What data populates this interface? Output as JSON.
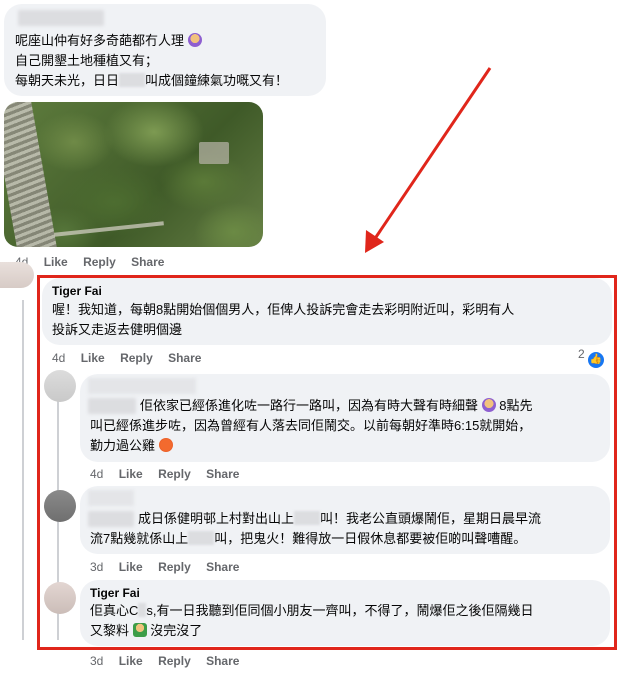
{
  "comment1": {
    "lines": [
      "呢座山仲有好多奇葩都冇人理",
      "自己開墾土地種植又有；",
      "每朝天未光，日日",
      "叫成個鐘練氣功嘅又有！"
    ],
    "time": "4d",
    "like": "Like",
    "reply": "Reply",
    "share": "Share"
  },
  "reply1": {
    "name": "Tiger Fai",
    "lines": [
      "喔！我知道，每朝8點開始個個男人，佢俾人投訴完會走去彩明附近叫，彩明有人",
      "投訴又走返去健明個邊"
    ],
    "time": "4d",
    "like": "Like",
    "reply": "Reply",
    "share": "Share",
    "reaction_count": "2"
  },
  "reply2": {
    "lines": [
      "佢依家已經係進化咗一路行一路叫，因為有時大聲有時細聲",
      "8點先",
      "叫已經係進步咗，因為曾經有人落去同佢鬧交。以前每朝好準時6:15就開始，",
      "勤力過公雞"
    ],
    "time": "4d",
    "like": "Like",
    "reply": "Reply",
    "share": "Share"
  },
  "reply3": {
    "lines": [
      "成日係健明邨上村對出山上",
      "叫！我老公直頭爆鬧佢，星期日晨早流",
      "流7點幾就係山上",
      "叫，把鬼火！難得放一日假休息都要被佢啲叫聲嘈醒。"
    ],
    "time": "3d",
    "like": "Like",
    "reply": "Reply",
    "share": "Share"
  },
  "reply4": {
    "name": "Tiger Fai",
    "lines": [
      "佢真心C",
      "s,有一日我聽到佢同個小朋友一齊叫，不得了，鬧爆佢之後佢隔幾日",
      "又黎料",
      "沒完沒了"
    ],
    "time": "3d",
    "like": "Like",
    "reply": "Reply",
    "share": "Share"
  },
  "colors": {
    "highlight": "#e0261b",
    "bubble": "#f0f2f5",
    "like_blue": "#1877f2"
  }
}
